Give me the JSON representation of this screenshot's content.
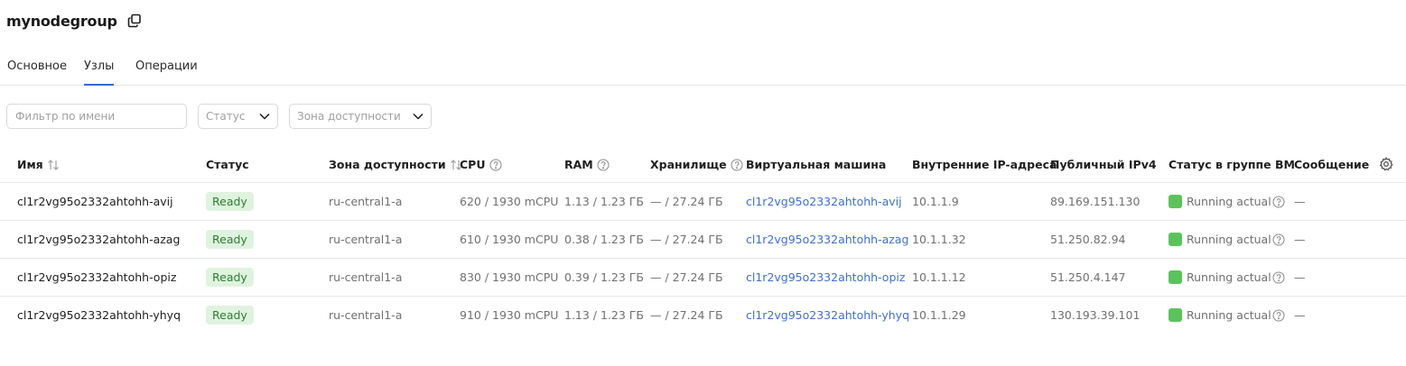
{
  "header": {
    "title": "mynodegroup",
    "copy_icon": "copy-icon"
  },
  "tabs": [
    {
      "label": "Основное",
      "active": false
    },
    {
      "label": "Узлы",
      "active": true
    },
    {
      "label": "Операции",
      "active": false
    }
  ],
  "filters": {
    "name_placeholder": "Фильтр по имени",
    "status_placeholder": "Статус",
    "zone_placeholder": "Зона доступности"
  },
  "table": {
    "columns": {
      "name": "Имя",
      "status": "Статус",
      "zone": "Зона доступности",
      "cpu": "CPU",
      "ram": "RAM",
      "storage": "Хранилище",
      "vm": "Виртуальная машина",
      "internal_ip": "Внутренние IP-адреса",
      "public_ip": "Публичный IPv4",
      "vm_status": "Статус в группе ВМ",
      "message": "Сообщение"
    },
    "rows": [
      {
        "name": "cl1r2vg95o2332ahtohh-avij",
        "status": "Ready",
        "zone": "ru-central1-a",
        "cpu": "620 / 1930 mCPU",
        "ram": "1.13 / 1.23 ГБ",
        "storage": "— / 27.24 ГБ",
        "vm": "cl1r2vg95o2332ahtohh-avij",
        "internal_ip": "10.1.1.9",
        "public_ip": "89.169.151.130",
        "vm_status": "Running actual",
        "message": "—"
      },
      {
        "name": "cl1r2vg95o2332ahtohh-azag",
        "status": "Ready",
        "zone": "ru-central1-a",
        "cpu": "610 / 1930 mCPU",
        "ram": "0.38 / 1.23 ГБ",
        "storage": "— / 27.24 ГБ",
        "vm": "cl1r2vg95o2332ahtohh-azag",
        "internal_ip": "10.1.1.32",
        "public_ip": "51.250.82.94",
        "vm_status": "Running actual",
        "message": "—"
      },
      {
        "name": "cl1r2vg95o2332ahtohh-opiz",
        "status": "Ready",
        "zone": "ru-central1-a",
        "cpu": "830 / 1930 mCPU",
        "ram": "0.39 / 1.23 ГБ",
        "storage": "— / 27.24 ГБ",
        "vm": "cl1r2vg95o2332ahtohh-opiz",
        "internal_ip": "10.1.1.12",
        "public_ip": "51.250.4.147",
        "vm_status": "Running actual",
        "message": "—"
      },
      {
        "name": "cl1r2vg95o2332ahtohh-yhyq",
        "status": "Ready",
        "zone": "ru-central1-a",
        "cpu": "910 / 1930 mCPU",
        "ram": "1.13 / 1.23 ГБ",
        "storage": "— / 27.24 ГБ",
        "vm": "cl1r2vg95o2332ahtohh-yhyq",
        "internal_ip": "10.1.1.29",
        "public_ip": "130.193.39.101",
        "vm_status": "Running actual",
        "message": "—"
      }
    ]
  },
  "colors": {
    "accent": "#2f6bd6",
    "link": "#3f6fd0",
    "ready_bg": "#dff3df",
    "ready_text": "#2e7d32",
    "running": "#5cc35c"
  }
}
